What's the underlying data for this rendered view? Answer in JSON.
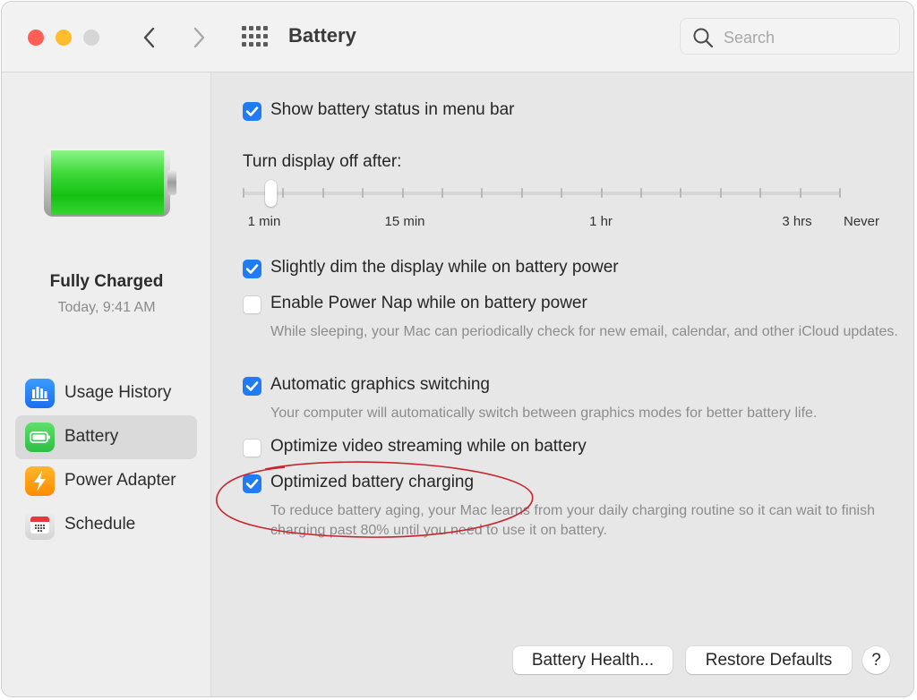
{
  "window": {
    "title": "Battery",
    "search_placeholder": "Search",
    "search_value": ""
  },
  "sidebar": {
    "status_title": "Fully Charged",
    "status_time": "Today, 9:41 AM",
    "battery_level_percent": 100,
    "items": [
      {
        "label": "Usage History",
        "icon": "bar-chart-icon",
        "color": "#1a7ef5",
        "selected": false
      },
      {
        "label": "Battery",
        "icon": "battery-icon",
        "color": "#34c759",
        "selected": true
      },
      {
        "label": "Power Adapter",
        "icon": "lightning-icon",
        "color": "#ff9f0a",
        "selected": false
      },
      {
        "label": "Schedule",
        "icon": "calendar-icon",
        "color": "#e5e5e5",
        "selected": false
      }
    ]
  },
  "settings": {
    "show_status": {
      "label": "Show battery status in menu bar",
      "checked": true
    },
    "display_off": {
      "label": "Turn display off after:",
      "value": "2 min",
      "tick_count": 16,
      "selected_tick_index": 1,
      "tick_labels": [
        "1 min",
        "15 min",
        "1 hr",
        "3 hrs",
        "Never"
      ]
    },
    "dim_display": {
      "label": "Slightly dim the display while on battery power",
      "checked": true
    },
    "power_nap": {
      "label": "Enable Power Nap while on battery power",
      "checked": false,
      "description": "While sleeping, your Mac can periodically check for new email, calendar, and other iCloud updates."
    },
    "graphics_switching": {
      "label": "Automatic graphics switching",
      "checked": true,
      "description": "Your computer will automatically switch between graphics modes for better battery life."
    },
    "video_streaming": {
      "label": "Optimize video streaming while on battery",
      "checked": false
    },
    "optimized_charging": {
      "label": "Optimized battery charging",
      "checked": true,
      "description": "To reduce battery aging, your Mac learns from your daily charging routine so it can wait to finish charging past 80% until you need to use it on battery."
    }
  },
  "buttons": {
    "battery_health": "Battery Health...",
    "restore_defaults": "Restore Defaults",
    "help": "?"
  },
  "colors": {
    "accent": "#1f7cf2",
    "annotation": "#c8242c"
  }
}
